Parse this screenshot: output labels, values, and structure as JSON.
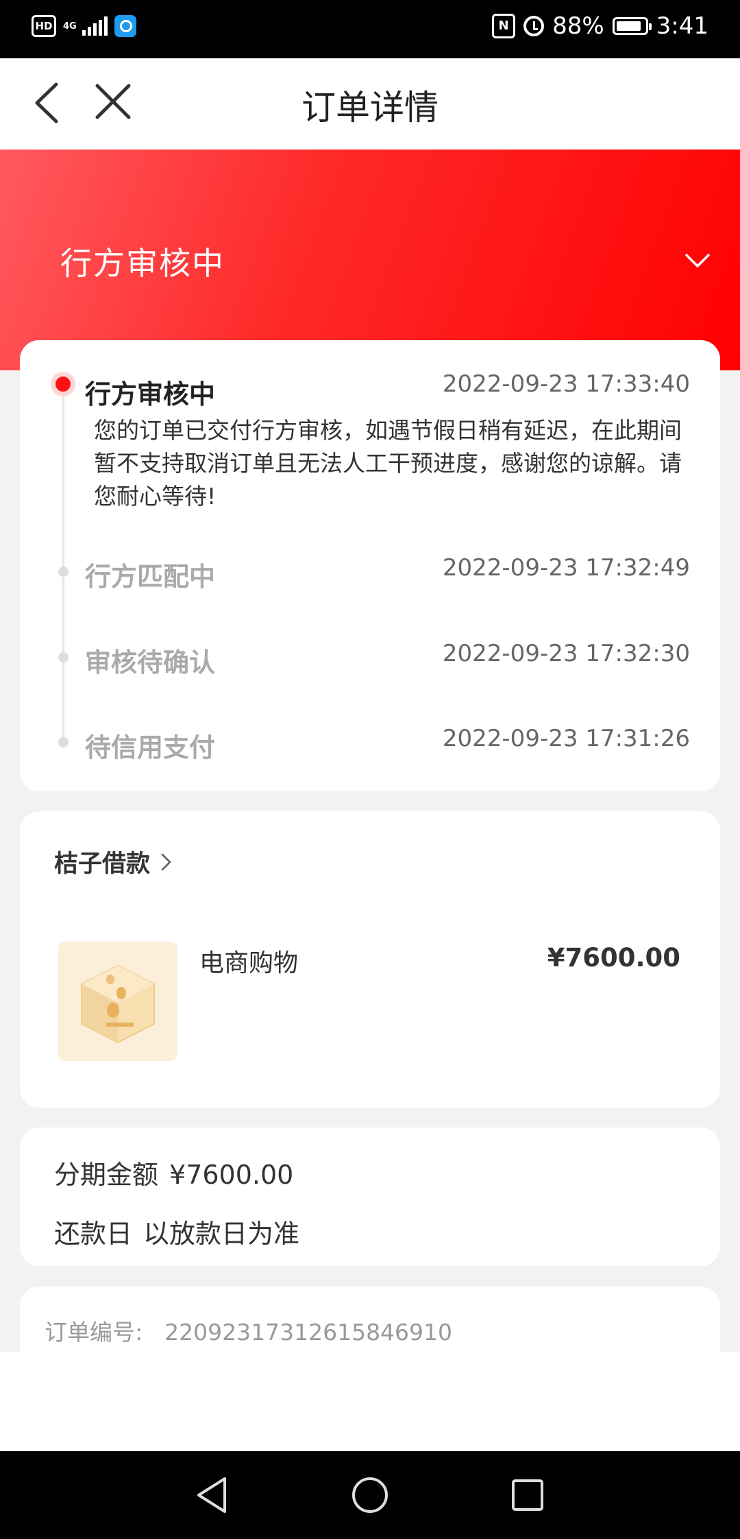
{
  "status_bar": {
    "hd": "HD",
    "network": "4G",
    "battery_percent": "88%",
    "battery_level": 0.88,
    "time": "3:41",
    "nfc": "N"
  },
  "nav": {
    "title": "订单详情"
  },
  "hero": {
    "status": "行方审核中",
    "accent_color": "#ff0000"
  },
  "timeline": [
    {
      "title": "行方审核中",
      "time": "2022-09-23 17:33:40",
      "desc": "您的订单已交付行方审核，如遇节假日稍有延迟，在此期间暂不支持取消订单且无法人工干预进度，感谢您的谅解。请您耐心等待!",
      "active": true
    },
    {
      "title": "行方匹配中",
      "time": "2022-09-23 17:32:49",
      "active": false
    },
    {
      "title": "审核待确认",
      "time": "2022-09-23 17:32:30",
      "active": false
    },
    {
      "title": "待信用支付",
      "time": "2022-09-23 17:31:26",
      "active": false
    }
  ],
  "product": {
    "lender": "桔子借款",
    "name": "电商购物",
    "price": "¥7600.00",
    "image_icon": "gold-coin-box-icon"
  },
  "installment": {
    "amount_label": "分期金额",
    "amount_value": "¥7600.00",
    "repay_label": "还款日",
    "repay_value": "以放款日为准"
  },
  "order": {
    "label": "订单编号:",
    "value": "22092317312615846910"
  }
}
